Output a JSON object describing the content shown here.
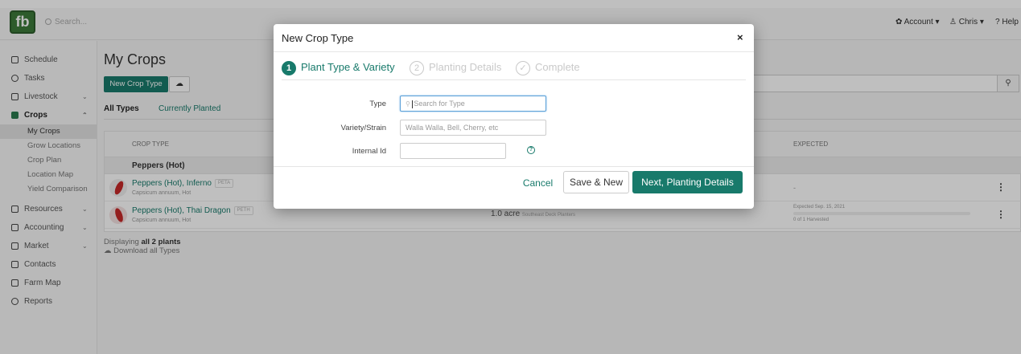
{
  "topbar": {
    "logo": "fb",
    "search_placeholder": "Search...",
    "account_label": "Account",
    "user_label": "Chris",
    "help_label": "Help"
  },
  "sidebar": {
    "items": [
      {
        "label": "Schedule",
        "icon": "calendar-icon"
      },
      {
        "label": "Tasks",
        "icon": "check-circle-icon"
      },
      {
        "label": "Livestock",
        "icon": "livestock-icon"
      },
      {
        "label": "Crops",
        "icon": "seedling-icon"
      },
      {
        "label": "Resources",
        "icon": "resources-icon"
      },
      {
        "label": "Accounting",
        "icon": "calculator-icon"
      },
      {
        "label": "Market",
        "icon": "market-icon"
      },
      {
        "label": "Contacts",
        "icon": "contacts-icon"
      },
      {
        "label": "Farm Map",
        "icon": "map-icon"
      },
      {
        "label": "Reports",
        "icon": "pie-chart-icon"
      }
    ],
    "crops_sub": [
      "My Crops",
      "Grow Locations",
      "Crop Plan",
      "Location Map",
      "Yield Comparison"
    ]
  },
  "main": {
    "title": "My Crops",
    "new_button": "New Crop Type",
    "tabs": [
      "All Types",
      "Currently Planted"
    ],
    "table": {
      "col_crop_type": "CROP TYPE",
      "col_expected": "EXPECTED",
      "group": "Peppers (Hot)",
      "rows": [
        {
          "name": "Peppers (Hot), Inferno",
          "badge": "PETA",
          "sub": "Capsicum annuum, Hot",
          "location": "",
          "expected": "-",
          "progress": ""
        },
        {
          "name": "Peppers (Hot), Thai Dragon",
          "badge": "PETH",
          "sub": "Capsicum annuum, Hot",
          "location": "1.0 acre",
          "location_sub": "Southeast Deck Planters",
          "expected": "Expected Sep. 15, 2021",
          "progress": "0 of 1 Harvested"
        }
      ]
    },
    "footer_prefix": "Displaying ",
    "footer_count": "all 2 plants",
    "download_label": "Download all Types"
  },
  "modal": {
    "title": "New Crop Type",
    "close": "×",
    "steps": [
      {
        "num": "1",
        "label": "Plant Type & Variety"
      },
      {
        "num": "2",
        "label": "Planting Details"
      },
      {
        "num": "✓",
        "label": "Complete"
      }
    ],
    "form": {
      "type_label": "Type",
      "type_placeholder": "Search for Type",
      "variety_label": "Variety/Strain",
      "variety_placeholder": "Walla Walla, Bell, Cherry, etc",
      "internal_label": "Internal Id",
      "internal_value": ""
    },
    "buttons": {
      "cancel": "Cancel",
      "save_new": "Save & New",
      "next": "Next, Planting Details"
    }
  },
  "colors": {
    "accent": "#187a6b",
    "logo": "#3d7a3a"
  }
}
